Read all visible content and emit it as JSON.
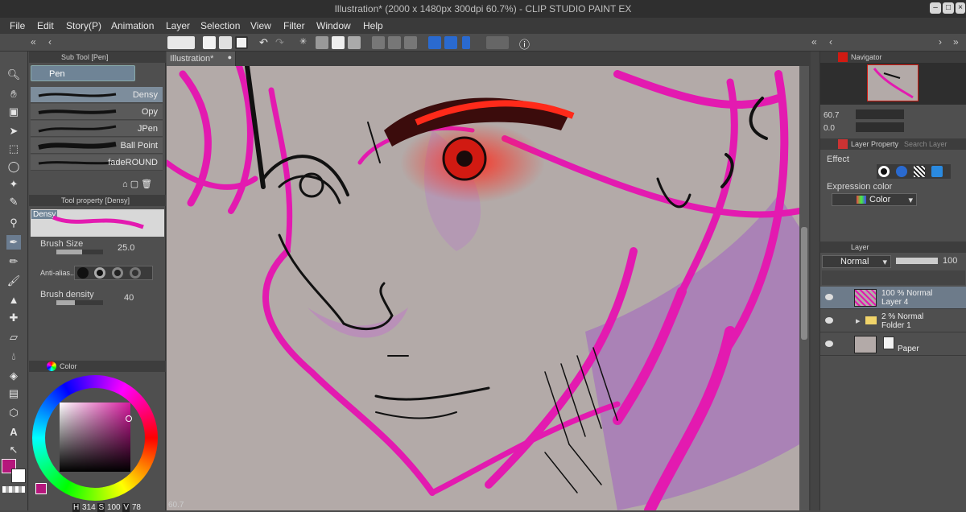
{
  "window": {
    "title": "Illustration* (2000 x 1480px 300dpi 60.7%) - CLIP STUDIO PAINT EX"
  },
  "menu": [
    "File",
    "Edit",
    "Story(P)",
    "Animation",
    "Layer",
    "Selection",
    "View",
    "Filter",
    "Window",
    "Help"
  ],
  "subtool": {
    "panel_title": "Sub Tool [Pen]",
    "group_tab": "Pen",
    "brushes": [
      "Densy",
      "Opy",
      "JPen",
      "Ball Point",
      "fadeROUND"
    ]
  },
  "toolprop": {
    "panel_title": "Tool property [Densy]",
    "preview_label": "Densy",
    "brush_size_label": "Brush Size",
    "brush_size_value": "25.0",
    "antialias_label": "Anti-alias...",
    "brush_density_label": "Brush density",
    "brush_density_value": "40"
  },
  "color_panel": {
    "title": "Color",
    "main_color": "#b5177c",
    "hsv": {
      "h_label": "H",
      "h": "314",
      "s_label": "S",
      "s": "100",
      "v_label": "V",
      "v": "78"
    }
  },
  "canvas": {
    "tab_label": "Illustration*",
    "zoom_readout": "60.7"
  },
  "navigator": {
    "title": "Navigator",
    "zoom": "60.7",
    "rotation": "0.0"
  },
  "layer_property": {
    "title": "Layer Property",
    "search_tab": "Search Layer",
    "effect_label": "Effect",
    "expression_label": "Expression color",
    "expression_value": "Color"
  },
  "layers": {
    "title": "Layer",
    "blend_mode": "Normal",
    "opacity": "100",
    "items": [
      {
        "line1": "100 % Normal",
        "line2": "Layer 4",
        "selected": true
      },
      {
        "line1": "2 % Normal",
        "line2": "Folder 1",
        "selected": false
      },
      {
        "line1": "",
        "line2": "Paper",
        "selected": false
      }
    ]
  },
  "colors": {
    "accent_pink": "#e31ab0",
    "canvas_bg": "#b3aaa8",
    "selection_blue": "#6d7b8a"
  }
}
